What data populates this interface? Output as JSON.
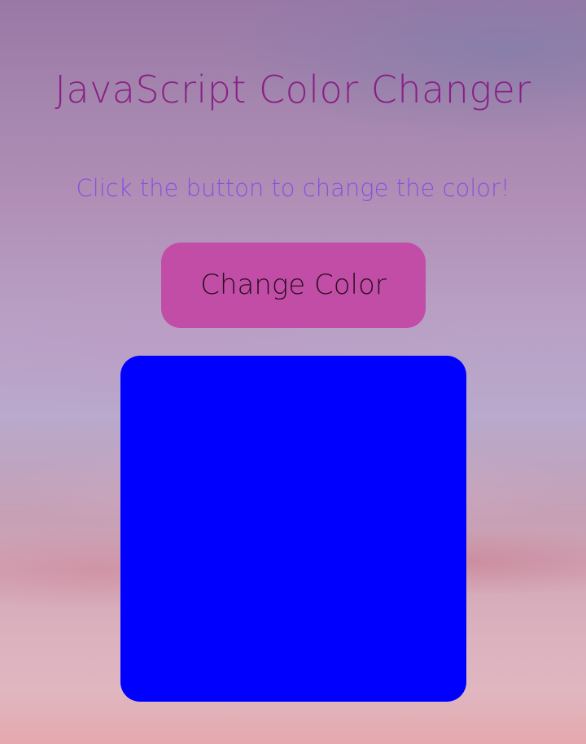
{
  "header": {
    "title": "JavaScript Color Changer",
    "instructions": "Click the button to change the color!"
  },
  "controls": {
    "change_button_label": "Change Color"
  },
  "color_box": {
    "current_color": "#0000ff"
  },
  "theme": {
    "title_color": "#8a1f86",
    "instructions_color": "#8a4fe0",
    "button_color": "#c24da6"
  }
}
